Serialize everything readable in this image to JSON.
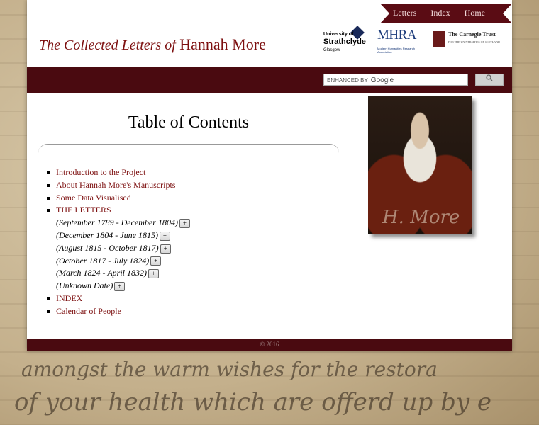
{
  "nav": {
    "letters": "Letters",
    "index": "Index",
    "home": "Home"
  },
  "site_title": {
    "part1": "The Collected Letters of",
    "part2": "Hannah More"
  },
  "logos": {
    "strathclyde": {
      "line1": "University of",
      "line2": "Strathclyde",
      "line3": "Glasgow"
    },
    "mhra": {
      "name": "MHRA",
      "sub": "Modern Humanities Research Association"
    },
    "carnegie": {
      "name": "The Carnegie Trust",
      "sub": "FOR THE UNIVERSITIES OF SCOTLAND"
    }
  },
  "search": {
    "placeholder": "ENHANCED BY",
    "brand": "Google",
    "button_icon": "search-icon"
  },
  "toc": {
    "title": "Table of Contents",
    "items": [
      "Introduction to the Project",
      "About Hannah More's Manuscripts",
      "Some Data Visualised",
      "THE LETTERS"
    ],
    "periods": [
      "(September 1789 - December 1804)",
      "(December 1804 - June 1815)",
      "(August 1815 - October 1817)",
      "(October 1817 - July 1824)",
      "(March 1824 - April 1832)",
      "(Unknown Date)"
    ],
    "expand_label": "+",
    "tail_items": [
      "INDEX",
      "Calendar of People"
    ]
  },
  "portrait": {
    "signature": "H. More"
  },
  "footer": {
    "copyright": "© 2016"
  },
  "background_text": [
    "amongst the warm wishes for the restora",
    "of your health which are offerd up by e"
  ],
  "colors": {
    "accent": "#7d1010",
    "band": "#4a0a10"
  }
}
